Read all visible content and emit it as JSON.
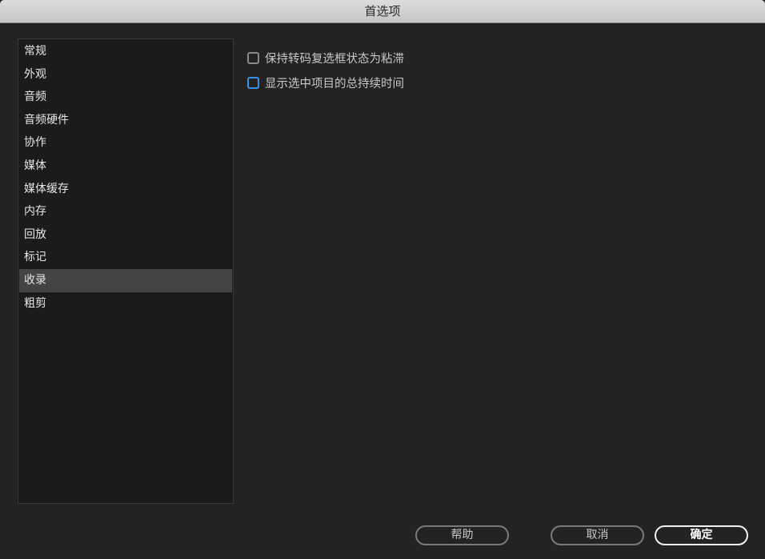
{
  "window": {
    "title": "首选项"
  },
  "sidebar": {
    "items": [
      {
        "label": "常规",
        "selected": false
      },
      {
        "label": "外观",
        "selected": false
      },
      {
        "label": "音频",
        "selected": false
      },
      {
        "label": "音频硬件",
        "selected": false
      },
      {
        "label": "协作",
        "selected": false
      },
      {
        "label": "媒体",
        "selected": false
      },
      {
        "label": "媒体缓存",
        "selected": false
      },
      {
        "label": "内存",
        "selected": false
      },
      {
        "label": "回放",
        "selected": false
      },
      {
        "label": "标记",
        "selected": false
      },
      {
        "label": "收录",
        "selected": true
      },
      {
        "label": "粗剪",
        "selected": false
      }
    ]
  },
  "options": [
    {
      "label": "保持转码复选框状态为粘滞",
      "checked": false,
      "focused": false
    },
    {
      "label": "显示选中项目的总持续时间",
      "checked": false,
      "focused": true
    }
  ],
  "buttons": {
    "help": "帮助",
    "cancel": "取消",
    "ok": "确定"
  },
  "colors": {
    "background": "#232323",
    "sidebar_bg": "#1b1b1b",
    "selection": "#444444",
    "focus_ring": "#3d8fe0"
  }
}
